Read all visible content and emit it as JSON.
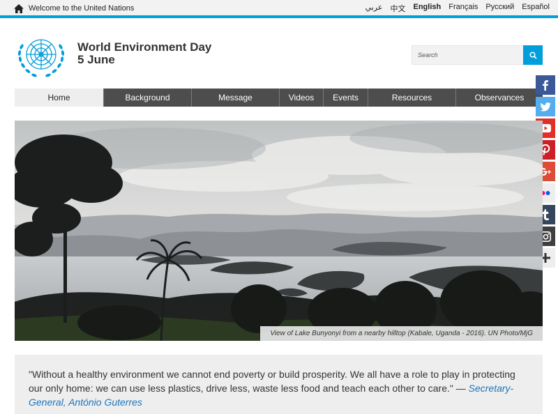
{
  "topbar": {
    "home_text": "Welcome to the United Nations",
    "languages": [
      {
        "label": "عربي",
        "active": false
      },
      {
        "label": "中文",
        "active": false
      },
      {
        "label": "English",
        "active": true
      },
      {
        "label": "Français",
        "active": false
      },
      {
        "label": "Русский",
        "active": false
      },
      {
        "label": "Español",
        "active": false
      }
    ]
  },
  "header": {
    "title_line1": "World Environment Day",
    "title_line2": "5 June",
    "search_placeholder": "Search"
  },
  "nav": {
    "items": [
      "Home",
      "Background",
      "Message",
      "Videos",
      "Events",
      "Resources",
      "Observances"
    ],
    "active_index": 0
  },
  "social": [
    {
      "icon": "facebook-icon",
      "glyph": "f",
      "color": "#3b5998"
    },
    {
      "icon": "twitter-icon",
      "glyph": "t",
      "color": "#55acee"
    },
    {
      "icon": "youtube-icon",
      "glyph": "▶",
      "color": "#e52d27"
    },
    {
      "icon": "pinterest-icon",
      "glyph": "p",
      "color": "#cb2027"
    },
    {
      "icon": "google-plus-icon",
      "glyph": "g+",
      "color": "#dd4b39"
    },
    {
      "icon": "flickr-icon",
      "glyph": "●●",
      "color": "#eeeeee"
    },
    {
      "icon": "tumblr-icon",
      "glyph": "t",
      "color": "#35465c"
    },
    {
      "icon": "instagram-icon",
      "glyph": "◙",
      "color": "#3f3f3f"
    },
    {
      "icon": "more-share-icon",
      "glyph": "+",
      "color": "#eeeeee"
    }
  ],
  "hero": {
    "caption": "View of Lake Bunyonyi from a nearby hilltop (Kabale, Uganda - 2016). UN Photo/MjG"
  },
  "quote": {
    "text": "\"Without a healthy environment we cannot end poverty or build prosperity. We all have a role to play in protecting our only home: we can use less plastics, drive less, waste less food and teach each other to care.\" — ",
    "attribution": "Secretary-General, António Guterres"
  },
  "colors": {
    "accent": "#009edb",
    "nav_bg": "#4d4d4d",
    "link": "#1b75bb"
  }
}
